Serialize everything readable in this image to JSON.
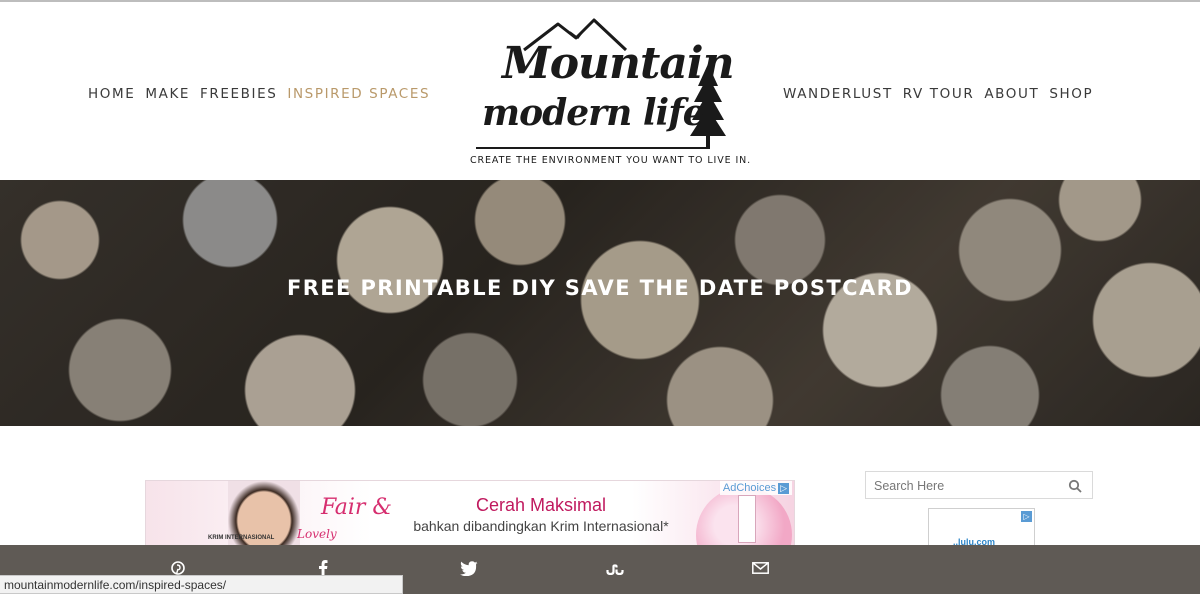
{
  "nav": {
    "left": [
      {
        "label": "HOME"
      },
      {
        "label": "MAKE"
      },
      {
        "label": "FREEBIES"
      },
      {
        "label": "INSPIRED SPACES",
        "active": true
      }
    ],
    "right": [
      {
        "label": "WANDERLUST"
      },
      {
        "label": "RV TOUR"
      },
      {
        "label": "ABOUT"
      },
      {
        "label": "SHOP"
      }
    ]
  },
  "logo": {
    "line1": "Mountain",
    "line2": "modern life",
    "tagline": "CREATE THE ENVIRONMENT YOU WANT TO LIVE IN."
  },
  "hero": {
    "title": "FREE PRINTABLE DIY SAVE THE DATE POSTCARD"
  },
  "ad": {
    "brand_line1": "Fair &",
    "brand_line2": "Lovely",
    "headline": "Cerah Maksimal",
    "subline": "bahkan dibandingkan Krim Internasional*",
    "model_caption": "KRIM INTERNASIONAL",
    "adchoices": "AdChoices"
  },
  "sidebar": {
    "search_placeholder": "Search Here",
    "ad_logo": "..lulu.com"
  },
  "share": {
    "buttons": [
      "pinterest-icon",
      "facebook-icon",
      "twitter-icon",
      "stumbleupon-icon",
      "email-icon"
    ]
  },
  "status_bar": {
    "url": "mountainmodernlife.com/inspired-spaces/"
  },
  "colors": {
    "nav_text": "#3a3a3a",
    "nav_active": "#b9996a",
    "share_bar": "#5f5a55",
    "ad_pink": "#c0195e"
  }
}
